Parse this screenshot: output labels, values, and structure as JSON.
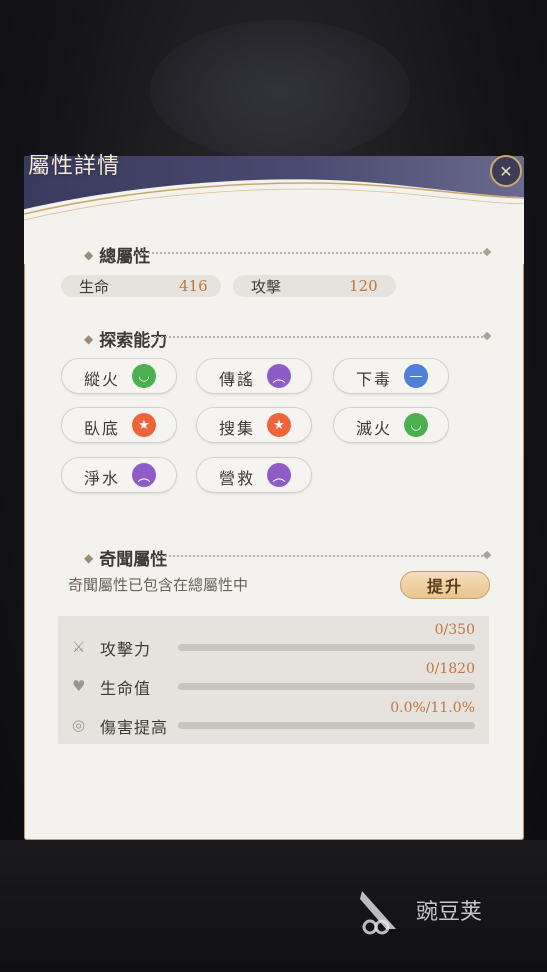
{
  "title": "屬性詳情",
  "close_icon": "close-icon",
  "total": {
    "heading": "總屬性",
    "stats": [
      {
        "label": "生命",
        "value": "416"
      },
      {
        "label": "攻擊",
        "value": "120"
      }
    ]
  },
  "explore": {
    "heading": "探索能力",
    "abilities": [
      {
        "label": "縱火",
        "mood": "happy",
        "color": "#4caf50"
      },
      {
        "label": "傳謠",
        "mood": "sad",
        "color": "#8e5cc7"
      },
      {
        "label": "下毒",
        "mood": "neutral",
        "color": "#4f7fd6"
      },
      {
        "label": "臥底",
        "mood": "excited",
        "color": "#f0643a"
      },
      {
        "label": "搜集",
        "mood": "excited",
        "color": "#f0643a"
      },
      {
        "label": "滅火",
        "mood": "happy",
        "color": "#4caf50"
      },
      {
        "label": "淨水",
        "mood": "sad",
        "color": "#8e5cc7"
      },
      {
        "label": "營救",
        "mood": "sad",
        "color": "#8e5cc7"
      }
    ]
  },
  "wonder": {
    "heading": "奇聞屬性",
    "description": "奇聞屬性已包含在總屬性中",
    "upgrade_label": "提升",
    "bars": [
      {
        "label": "攻擊力",
        "value": "0/350",
        "fraction": 0,
        "icon": "sword-icon"
      },
      {
        "label": "生命值",
        "value": "0/1820",
        "fraction": 0,
        "icon": "heart-plus-icon"
      },
      {
        "label": "傷害提高",
        "value": "0.0%/11.0%",
        "fraction": 0,
        "icon": "damage-boost-icon"
      }
    ]
  },
  "watermark": "豌豆荚"
}
